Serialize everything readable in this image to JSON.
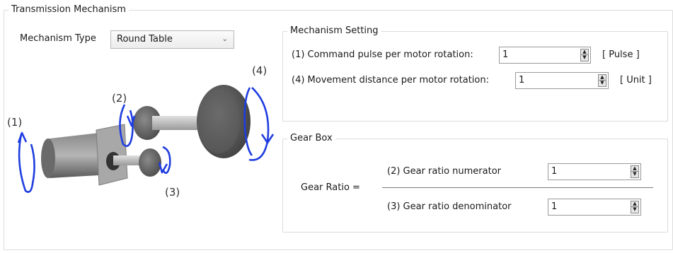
{
  "transmission": {
    "title": "Transmission Mechanism",
    "mechanism_type_label": "Mechanism Type",
    "mechanism_type_value": "Round Table"
  },
  "diagram": {
    "labels": [
      "(1)",
      "(2)",
      "(3)",
      "(4)"
    ]
  },
  "mechanism_setting": {
    "title": "Mechanism Setting",
    "command_pulse_label": "(1) Command pulse per motor rotation:",
    "command_pulse_value": "1",
    "command_pulse_unit": "[ Pulse ]",
    "movement_distance_label": "(4) Movement distance per motor rotation:",
    "movement_distance_value": "1",
    "movement_distance_unit": "[ Unit ]"
  },
  "gear_box": {
    "title": "Gear Box",
    "gear_ratio_label": "Gear Ratio =",
    "numerator_label": "(2) Gear ratio numerator",
    "numerator_value": "1",
    "denominator_label": "(3) Gear ratio denominator",
    "denominator_value": "1"
  },
  "icons": {
    "spin_up": "▲",
    "spin_down": "▼",
    "dropdown": "⌄"
  },
  "colors": {
    "rotation_arrow": "#1f3de0",
    "group_border": "#dcdcdc"
  }
}
